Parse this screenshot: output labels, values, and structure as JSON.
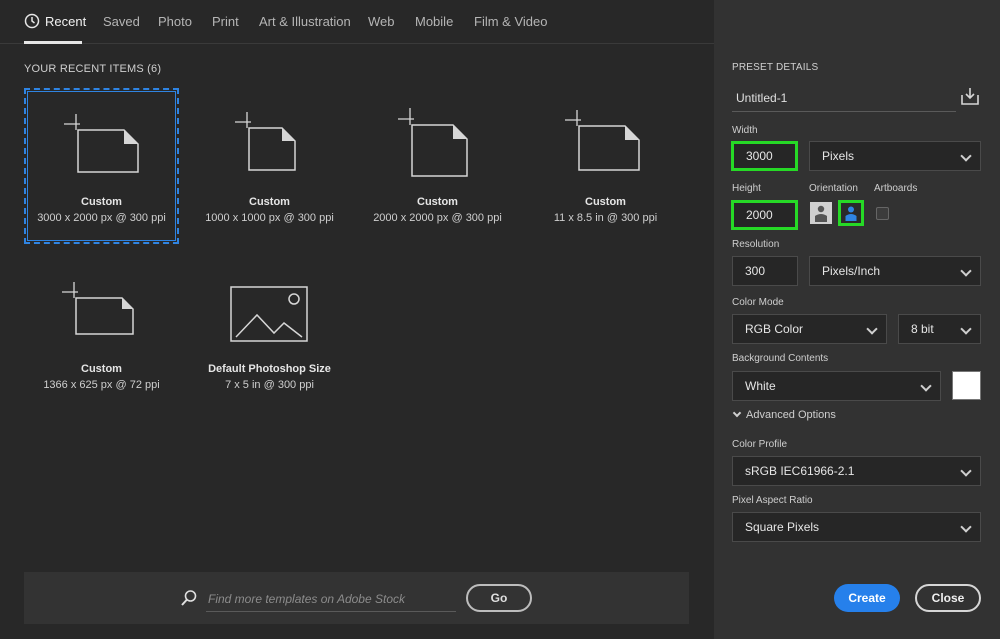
{
  "tabs": [
    {
      "label": "Recent"
    },
    {
      "label": "Saved"
    },
    {
      "label": "Photo"
    },
    {
      "label": "Print"
    },
    {
      "label": "Art & Illustration"
    },
    {
      "label": "Web"
    },
    {
      "label": "Mobile"
    },
    {
      "label": "Film & Video"
    }
  ],
  "recent": {
    "title": "YOUR RECENT ITEMS  (6)",
    "items": [
      {
        "name": "Custom",
        "desc": "3000 x 2000 px @ 300 ppi",
        "icon": "document-icon"
      },
      {
        "name": "Custom",
        "desc": "1000 x 1000 px @ 300 ppi",
        "icon": "document-icon"
      },
      {
        "name": "Custom",
        "desc": "2000 x 2000 px @ 300 ppi",
        "icon": "document-icon"
      },
      {
        "name": "Custom",
        "desc": "11 x 8.5 in @ 300 ppi",
        "icon": "document-icon"
      },
      {
        "name": "Custom",
        "desc": "1366 x 625 px @ 72 ppi",
        "icon": "document-icon"
      },
      {
        "name": "Default Photoshop Size",
        "desc": "7 x 5 in @ 300 ppi",
        "icon": "image-icon"
      }
    ]
  },
  "search": {
    "placeholder": "Find more templates on Adobe Stock",
    "go_label": "Go"
  },
  "preset": {
    "title": "PRESET DETAILS",
    "name": "Untitled-1",
    "width_label": "Width",
    "width": "3000",
    "unit": "Pixels",
    "height_label": "Height",
    "height": "2000",
    "orientation_label": "Orientation",
    "artboards_label": "Artboards",
    "resolution_label": "Resolution",
    "resolution": "300",
    "resolution_unit": "Pixels/Inch",
    "color_mode_label": "Color Mode",
    "color_mode": "RGB Color",
    "bit_depth": "8 bit",
    "background_label": "Background Contents",
    "background": "White",
    "advanced_label": "Advanced Options",
    "color_profile_label": "Color Profile",
    "color_profile": "sRGB IEC61966-2.1",
    "pixel_aspect_label": "Pixel Aspect Ratio",
    "pixel_aspect": "Square Pixels"
  },
  "buttons": {
    "create": "Create",
    "close": "Close"
  },
  "colors": {
    "accent": "#2680eb",
    "highlight": "#26d926",
    "selection": "#2f84e2"
  }
}
